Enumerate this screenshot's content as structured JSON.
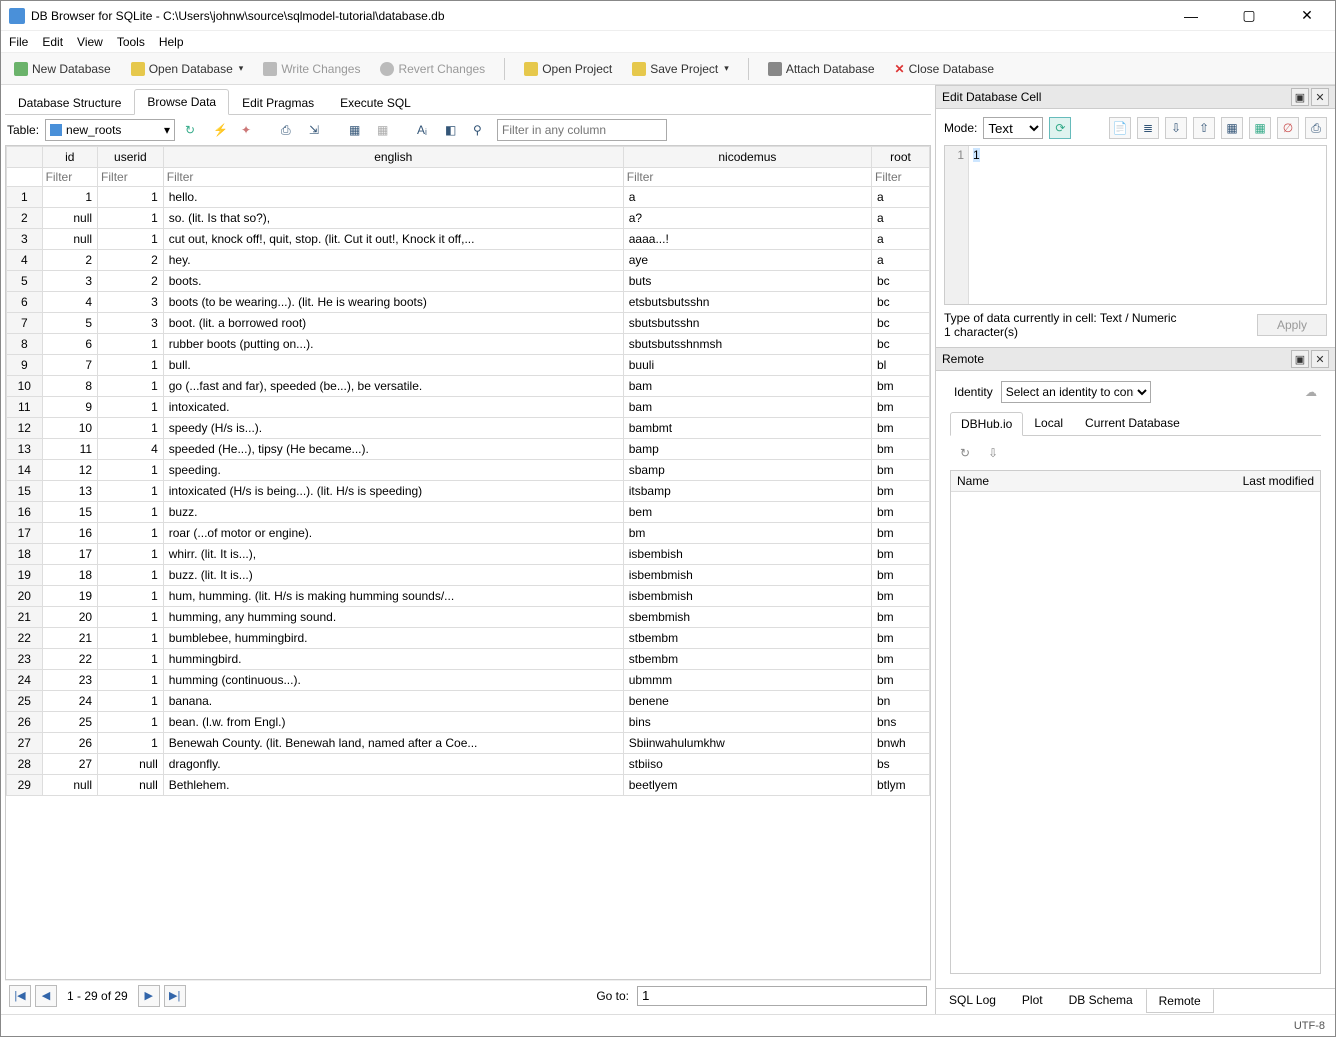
{
  "title": "DB Browser for SQLite - C:\\Users\\johnw\\source\\sqlmodel-tutorial\\database.db",
  "window": {
    "min": "—",
    "max": "▢",
    "close": "✕"
  },
  "menubar": [
    "File",
    "Edit",
    "View",
    "Tools",
    "Help"
  ],
  "toolbar": [
    {
      "label": "New Database",
      "icon": "ic-db"
    },
    {
      "label": "Open Database",
      "icon": "ic-db2",
      "dropdown": true
    },
    {
      "label": "Write Changes",
      "icon": "ic-wr",
      "disabled": true
    },
    {
      "label": "Revert Changes",
      "icon": "ic-rev",
      "disabled": true
    },
    {
      "sep": true
    },
    {
      "label": "Open Project",
      "icon": "ic-proj"
    },
    {
      "label": "Save Project",
      "icon": "ic-proj",
      "dropdown": true
    },
    {
      "sep": true
    },
    {
      "label": "Attach Database",
      "icon": "ic-att"
    },
    {
      "label": "Close Database",
      "icon": "ic-cls",
      "x": true
    }
  ],
  "tabs": [
    "Database Structure",
    "Browse Data",
    "Edit Pragmas",
    "Execute SQL"
  ],
  "active_tab": 1,
  "table_label": "Table:",
  "table_selected": "new_roots",
  "filter_any_placeholder": "Filter in any column",
  "columns": [
    "",
    "id",
    "userid",
    "english",
    "nicodemus",
    "root"
  ],
  "filter_placeholder": "Filter",
  "rows": [
    {
      "n": 1,
      "id": "1",
      "userid": "1",
      "english": "hello.",
      "nicodemus": "a",
      "root": "a"
    },
    {
      "n": 2,
      "id": "null",
      "userid": "1",
      "english": "so. (lit. Is that so?),",
      "nicodemus": "a?",
      "root": "a"
    },
    {
      "n": 3,
      "id": "null",
      "userid": "1",
      "english": "cut out, knock off!, quit, stop. (lit. Cut it out!, Knock it off,...",
      "nicodemus": "aaaa...!",
      "root": "a"
    },
    {
      "n": 4,
      "id": "2",
      "userid": "2",
      "english": "hey.",
      "nicodemus": "aye",
      "root": "a"
    },
    {
      "n": 5,
      "id": "3",
      "userid": "2",
      "english": "boots.",
      "nicodemus": "buts",
      "root": "bc"
    },
    {
      "n": 6,
      "id": "4",
      "userid": "3",
      "english": "boots (to be wearing...). (lit. He is wearing boots)",
      "nicodemus": "etsbutsbutsshn",
      "root": "bc"
    },
    {
      "n": 7,
      "id": "5",
      "userid": "3",
      "english": "boot. (lit. a borrowed root)",
      "nicodemus": "sbutsbutsshn",
      "root": "bc"
    },
    {
      "n": 8,
      "id": "6",
      "userid": "1",
      "english": "rubber boots (putting on...).",
      "nicodemus": "sbutsbutsshnmsh",
      "root": "bc"
    },
    {
      "n": 9,
      "id": "7",
      "userid": "1",
      "english": "bull.",
      "nicodemus": "buuli",
      "root": "bl"
    },
    {
      "n": 10,
      "id": "8",
      "userid": "1",
      "english": "go (...fast and far), speeded (be...), be versatile.",
      "nicodemus": "bam",
      "root": "bm"
    },
    {
      "n": 11,
      "id": "9",
      "userid": "1",
      "english": "intoxicated.",
      "nicodemus": "bam",
      "root": "bm"
    },
    {
      "n": 12,
      "id": "10",
      "userid": "1",
      "english": "speedy (H/s is...).",
      "nicodemus": "bambmt",
      "root": "bm"
    },
    {
      "n": 13,
      "id": "11",
      "userid": "4",
      "english": "speeded (He...), tipsy (He became...).",
      "nicodemus": "bamp",
      "root": "bm"
    },
    {
      "n": 14,
      "id": "12",
      "userid": "1",
      "english": "speeding.",
      "nicodemus": "sbamp",
      "root": "bm"
    },
    {
      "n": 15,
      "id": "13",
      "userid": "1",
      "english": "intoxicated (H/s is being...). (lit. H/s is speeding)",
      "nicodemus": "itsbamp",
      "root": "bm"
    },
    {
      "n": 16,
      "id": "15",
      "userid": "1",
      "english": "buzz.",
      "nicodemus": "bem",
      "root": "bm"
    },
    {
      "n": 17,
      "id": "16",
      "userid": "1",
      "english": "roar (...of motor or engine).",
      "nicodemus": "bm",
      "root": "bm"
    },
    {
      "n": 18,
      "id": "17",
      "userid": "1",
      "english": "whirr. (lit. It is...),",
      "nicodemus": "isbembish",
      "root": "bm"
    },
    {
      "n": 19,
      "id": "18",
      "userid": "1",
      "english": "buzz. (lit. It is...)",
      "nicodemus": "isbembmish",
      "root": "bm"
    },
    {
      "n": 20,
      "id": "19",
      "userid": "1",
      "english": "hum, humming. (lit. H/s is making humming sounds/...",
      "nicodemus": "isbembmish",
      "root": "bm"
    },
    {
      "n": 21,
      "id": "20",
      "userid": "1",
      "english": "humming, any humming sound.",
      "nicodemus": "sbembmish",
      "root": "bm"
    },
    {
      "n": 22,
      "id": "21",
      "userid": "1",
      "english": "bumblebee, hummingbird.",
      "nicodemus": "stbembm",
      "root": "bm"
    },
    {
      "n": 23,
      "id": "22",
      "userid": "1",
      "english": "hummingbird.",
      "nicodemus": "stbembm",
      "root": "bm"
    },
    {
      "n": 24,
      "id": "23",
      "userid": "1",
      "english": "humming (continuous...).",
      "nicodemus": "ubmmm",
      "root": "bm"
    },
    {
      "n": 25,
      "id": "24",
      "userid": "1",
      "english": "banana.",
      "nicodemus": "benene",
      "root": "bn"
    },
    {
      "n": 26,
      "id": "25",
      "userid": "1",
      "english": "bean. (l.w. from Engl.)",
      "nicodemus": "bins",
      "root": "bns"
    },
    {
      "n": 27,
      "id": "26",
      "userid": "1",
      "english": "Benewah County. (lit. Benewah land, named after a Coe...",
      "nicodemus": "Sbiinwahulumkhw",
      "root": "bnwh"
    },
    {
      "n": 28,
      "id": "27",
      "userid": "null",
      "english": "dragonfly.",
      "nicodemus": "stbiiso",
      "root": "bs"
    },
    {
      "n": 29,
      "id": "null",
      "userid": "null",
      "english": "Bethlehem.",
      "nicodemus": "beetlyem",
      "root": "btlym"
    }
  ],
  "pager": {
    "range": "1 - 29 of 29",
    "goto": "Go to:",
    "goto_val": "1"
  },
  "edit_cell": {
    "title": "Edit Database Cell",
    "mode_label": "Mode:",
    "mode": "Text",
    "line": "1",
    "content": "1",
    "type_info": "Type of data currently in cell: Text / Numeric",
    "char_info": "1 character(s)",
    "apply": "Apply"
  },
  "remote": {
    "title": "Remote",
    "identity_label": "Identity",
    "identity_placeholder": "Select an identity to connect",
    "tabs": [
      "DBHub.io",
      "Local",
      "Current Database"
    ],
    "cols": {
      "name": "Name",
      "modified": "Last modified"
    }
  },
  "bottom_tabs": [
    "SQL Log",
    "Plot",
    "DB Schema",
    "Remote"
  ],
  "status": "UTF-8"
}
